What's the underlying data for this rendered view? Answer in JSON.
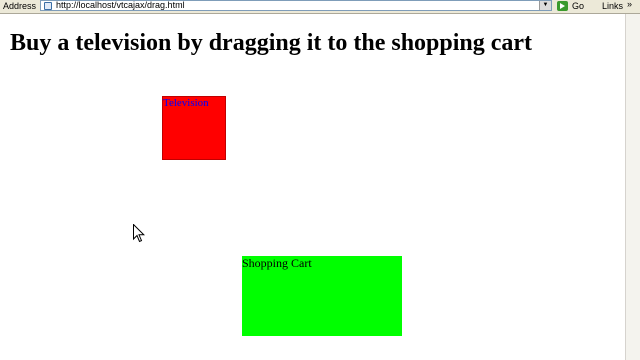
{
  "browser": {
    "address_label": "Address",
    "url": "http://localhost/vtcajax/drag.html",
    "go_label": "Go",
    "links_label": "Links",
    "overflow_chevron": "»",
    "page_icon": "page-icon",
    "go_icon": "go-arrow-icon"
  },
  "page": {
    "heading": "Buy a television by dragging it to the shopping cart"
  },
  "television": {
    "label": "Television",
    "background_color": "#ff0000",
    "text_color": "#0000ff"
  },
  "shopping_cart": {
    "label": "Shopping Cart",
    "background_color": "#00ff00"
  }
}
